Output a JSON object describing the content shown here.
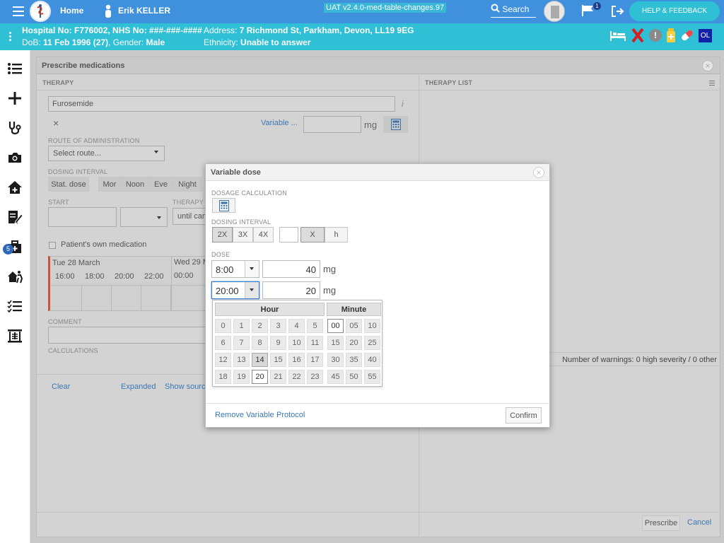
{
  "topbar": {
    "home_label": "Home",
    "user_name": "Erik KELLER",
    "build": "UAT v2.4.0-med-table-changes.97",
    "search_label": "Search",
    "flag_count": "1",
    "help_label": "HELP & FEEDBACK"
  },
  "patient": {
    "hospital_no": "Hospital No: F776002, NHS No: ###-###-####",
    "dob_prefix": "DoB: ",
    "dob_value": "11 Feb 1996 (27)",
    "gender_prefix": ", Gender: ",
    "gender_value": "Male",
    "address_prefix": "Address: ",
    "address_value": "7 Richmond St, Parkham, Devon, LL19 9EG",
    "ethnicity_prefix": "Ethnicity: ",
    "ethnicity_value": "Unable to answer",
    "ol_badge": "OL"
  },
  "sidebar": {
    "badge_count": "5"
  },
  "prescribe": {
    "title": "Prescribe medications",
    "therapy_header": "THERAPY",
    "therapy_list_header": "THERAPY LIST",
    "drug_value": "Furosemide",
    "variable_link": "Variable ...",
    "unit": "mg",
    "route_label": "ROUTE OF ADMINISTRATION",
    "route_placeholder": "Select route...",
    "dosing_interval_label": "DOSING INTERVAL",
    "stat_dose": "Stat. dose",
    "times": [
      "Mor",
      "Noon",
      "Eve",
      "Night"
    ],
    "start_label": "START",
    "therapy_duration_label": "THERAPY D",
    "until_label": "until can",
    "own_med_label": "Patient's own medication",
    "timeline_day1": "Tue 28 March",
    "timeline_day2": "Wed 29 M",
    "timeline_hours": [
      "16:00",
      "18:00",
      "20:00",
      "22:00",
      "00:00",
      "00"
    ],
    "comment_label": "COMMENT",
    "calculations_label": "CALCULATIONS",
    "clear_link": "Clear",
    "expanded_link": "Expanded",
    "show_source_link": "Show source",
    "warnings_text": "Number of warnings: 0 high severity / 0 other",
    "prescribe_button": "Prescribe",
    "cancel_link": "Cancel"
  },
  "variable_dose": {
    "title": "Variable dose",
    "dosage_calc_label": "DOSAGE CALCULATION",
    "dosing_interval_label": "DOSING INTERVAL",
    "interval_options": [
      "2X",
      "3X",
      "4X"
    ],
    "x_label": "X",
    "h_label": "h",
    "dose_label": "DOSE",
    "dose1_time": "8:00",
    "dose1_value": "40",
    "dose2_time": "20:00",
    "dose2_value": "20",
    "unit": "mg",
    "hour_header": "Hour",
    "minute_header": "Minute",
    "hours": [
      "0",
      "1",
      "2",
      "3",
      "4",
      "5",
      "6",
      "7",
      "8",
      "9",
      "10",
      "11",
      "12",
      "13",
      "14",
      "15",
      "16",
      "17",
      "18",
      "19",
      "20",
      "21",
      "22",
      "23"
    ],
    "minutes": [
      "00",
      "05",
      "10",
      "15",
      "20",
      "25",
      "30",
      "35",
      "40",
      "45",
      "50",
      "55"
    ],
    "remove_variable": "Remove Variable",
    "protocol": "Protocol",
    "confirm": "Confirm"
  }
}
